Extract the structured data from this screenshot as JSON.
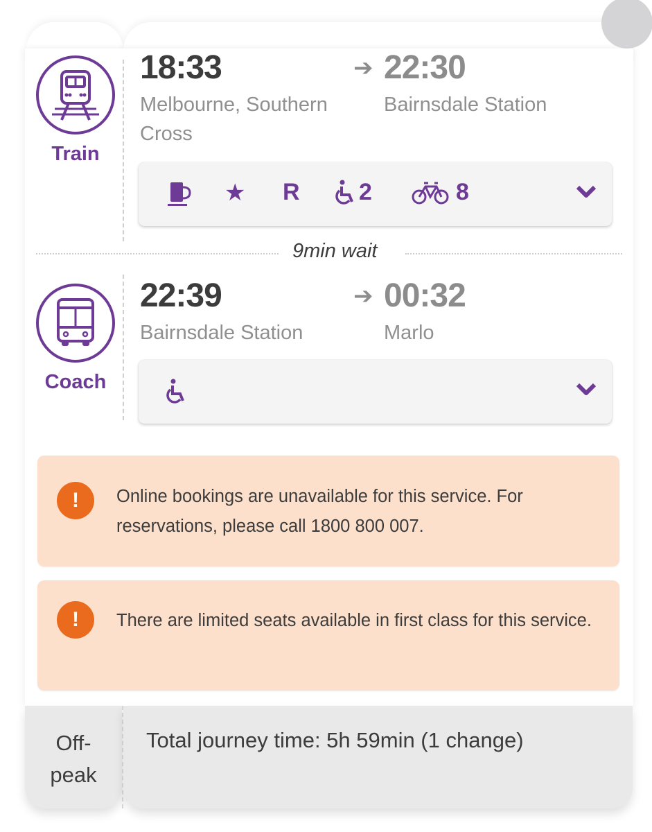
{
  "colors": {
    "accent": "#6d3a96",
    "alert_bg": "#fde0cb",
    "alert_icon": "#ea6a1e",
    "footer_bg": "#e9e9ea"
  },
  "legs": [
    {
      "mode": "Train",
      "mode_icon": "train-icon",
      "departure_time": "18:33",
      "departure_place": "Melbourne, Southern Cross",
      "arrival_arrow": "➔",
      "arrival_time": "22:30",
      "arrival_place": "Bairnsdale Station",
      "amenities": [
        {
          "icon": "coffee-cup-icon",
          "label": ""
        },
        {
          "icon": "star-icon",
          "label": "★"
        },
        {
          "icon": "reservation-icon",
          "label": "R"
        },
        {
          "icon": "wheelchair-icon",
          "label": "2"
        },
        {
          "icon": "bicycle-icon",
          "label": "8"
        }
      ],
      "expand_icon": "chevron-down-icon"
    },
    {
      "mode": "Coach",
      "mode_icon": "bus-icon",
      "departure_time": "22:39",
      "departure_place": "Bairnsdale Station",
      "arrival_arrow": "➔",
      "arrival_time": "00:32",
      "arrival_place": "Marlo",
      "amenities": [
        {
          "icon": "wheelchair-icon",
          "label": ""
        }
      ],
      "expand_icon": "chevron-down-icon"
    }
  ],
  "connection": {
    "wait": "9min wait"
  },
  "alerts": [
    {
      "icon": "!",
      "text": "Online bookings are unavailable for this service. For reservations, please call 1800 800 007."
    },
    {
      "icon": "!",
      "text": "There are limited seats available in first class for this service."
    }
  ],
  "footer": {
    "fare_type": "Off-peak",
    "summary": "Total journey time: 5h 59min (1 change)"
  }
}
